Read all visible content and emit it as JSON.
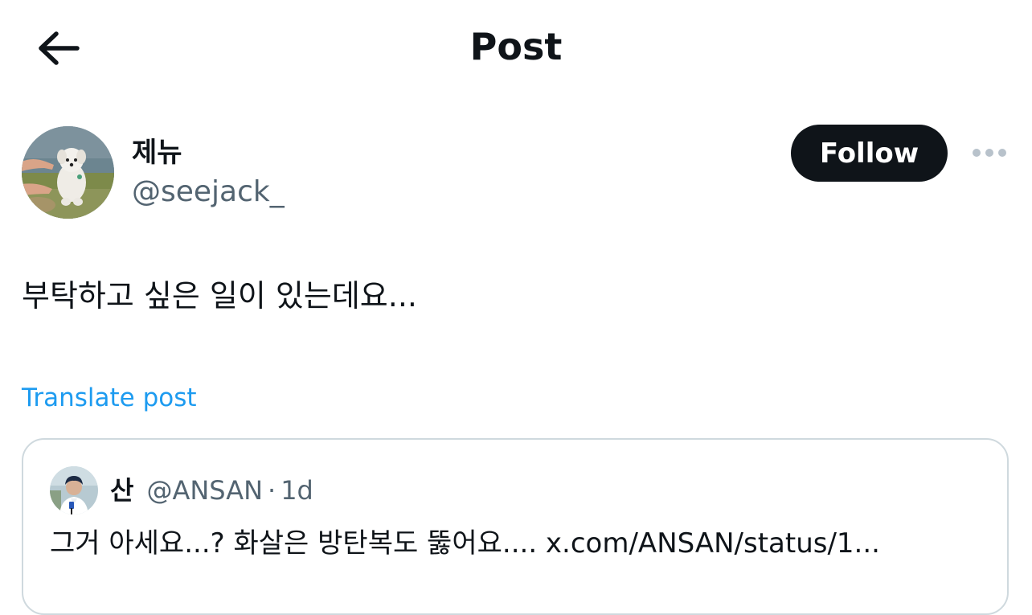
{
  "header": {
    "title": "Post",
    "back_icon": "arrow-left-icon"
  },
  "author": {
    "display_name": "제뉴",
    "handle": "@seejack_",
    "avatar_icon": "dog-photo-avatar",
    "follow_label": "Follow",
    "more_icon": "more-horizontal-icon"
  },
  "post": {
    "text": "부탁하고 싶은 일이 있는데요...",
    "translate_label": "Translate post"
  },
  "quoted_post": {
    "display_name": "산",
    "handle": "@ANSAN",
    "separator": "·",
    "time": "1d",
    "text": "그거 아세요...? 화살은 방탄복도 뚫어요.... x.com/ANSAN/status/1...",
    "avatar_icon": "reporter-photo-avatar"
  },
  "colors": {
    "text_primary": "#0f1419",
    "text_secondary": "#536471",
    "link": "#1d9bf0",
    "border": "#cfd9de",
    "button_bg": "#0f1419"
  }
}
